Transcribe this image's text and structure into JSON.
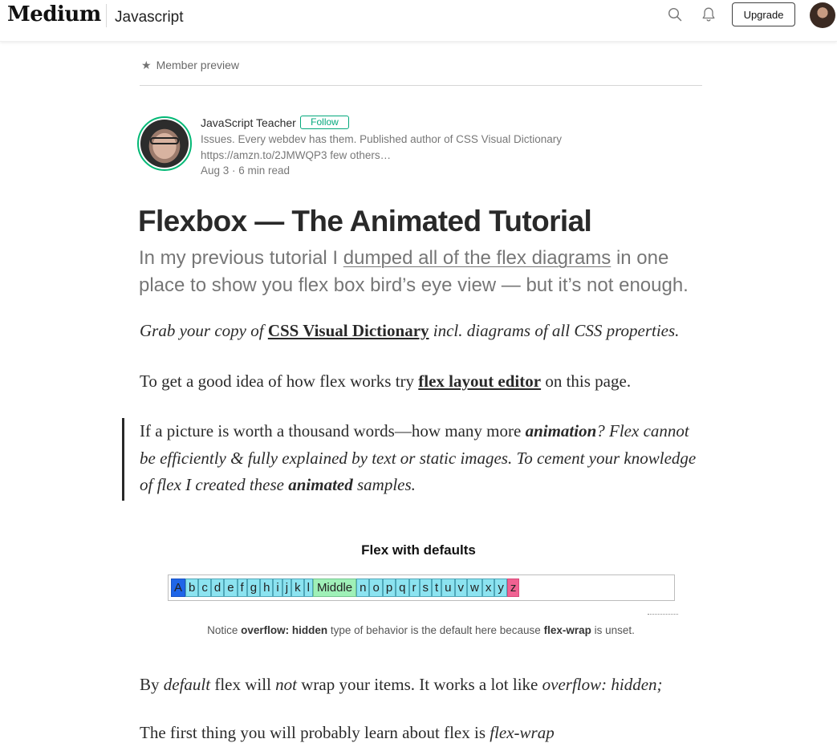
{
  "header": {
    "logo": "Medium",
    "publication": "Javascript",
    "upgrade_label": "Upgrade"
  },
  "member_preview": {
    "label": "Member preview"
  },
  "author": {
    "name": "JavaScript Teacher",
    "follow_label": "Follow",
    "bio_line1": "Issues. Every webdev has them. Published author of CSS Visual Dictionary",
    "bio_line2": "https://amzn.to/2JMWQP3 few others…",
    "date": "Aug 3",
    "read_time": "6 min read"
  },
  "article": {
    "title": "Flexbox — The Animated Tutorial",
    "subtitle_pre": "In my previous tutorial I ",
    "subtitle_link": "dumped all of the flex diagrams",
    "subtitle_post": " in one place to show you flex box bird’s eye view — but it’s not enough.",
    "p1_pre": "Grab your copy of ",
    "p1_link": "CSS Visual Dictionary",
    "p1_post": " incl. diagrams of all CSS properties.",
    "p2_pre": "To get a good idea of how flex works try ",
    "p2_link": "flex layout editor",
    "p2_post": " on this page.",
    "quote_a": "If a picture is worth a thousand words—how many more ",
    "quote_b": "animation",
    "quote_c": "? Flex cannot be efficiently & fully explained by text or static images. To cement your knowledge of flex I created these ",
    "quote_d": "animated",
    "quote_e": " samples.",
    "p5_a": "By ",
    "p5_b": "default",
    "p5_c": " flex will ",
    "p5_d": "not",
    "p5_e": " wrap your items. It works a lot like ",
    "p5_f": "overflow: hidden;",
    "p6_a": "The first thing you will probably learn about flex is ",
    "p6_b": "flex-wrap"
  },
  "figure": {
    "title": "Flex with defaults",
    "items": [
      "A",
      "b",
      "c",
      "d",
      "e",
      "f",
      "g",
      "h",
      "i",
      "j",
      "k",
      "l",
      "Middle",
      "n",
      "o",
      "p",
      "q",
      "r",
      "s",
      "t",
      "u",
      "v",
      "w",
      "x",
      "y",
      "z"
    ],
    "caption_a": "Notice ",
    "caption_b": "overflow: hidden",
    "caption_c": " type of behavior is the default here because ",
    "caption_d": "flex-wrap",
    "caption_e": " is unset."
  },
  "colors": {
    "follow_green": "#03a87c",
    "item_blue": "#8ce3f0",
    "item_first": "#1f66e8",
    "item_middle": "#9ff0b7",
    "item_last": "#f06292"
  }
}
